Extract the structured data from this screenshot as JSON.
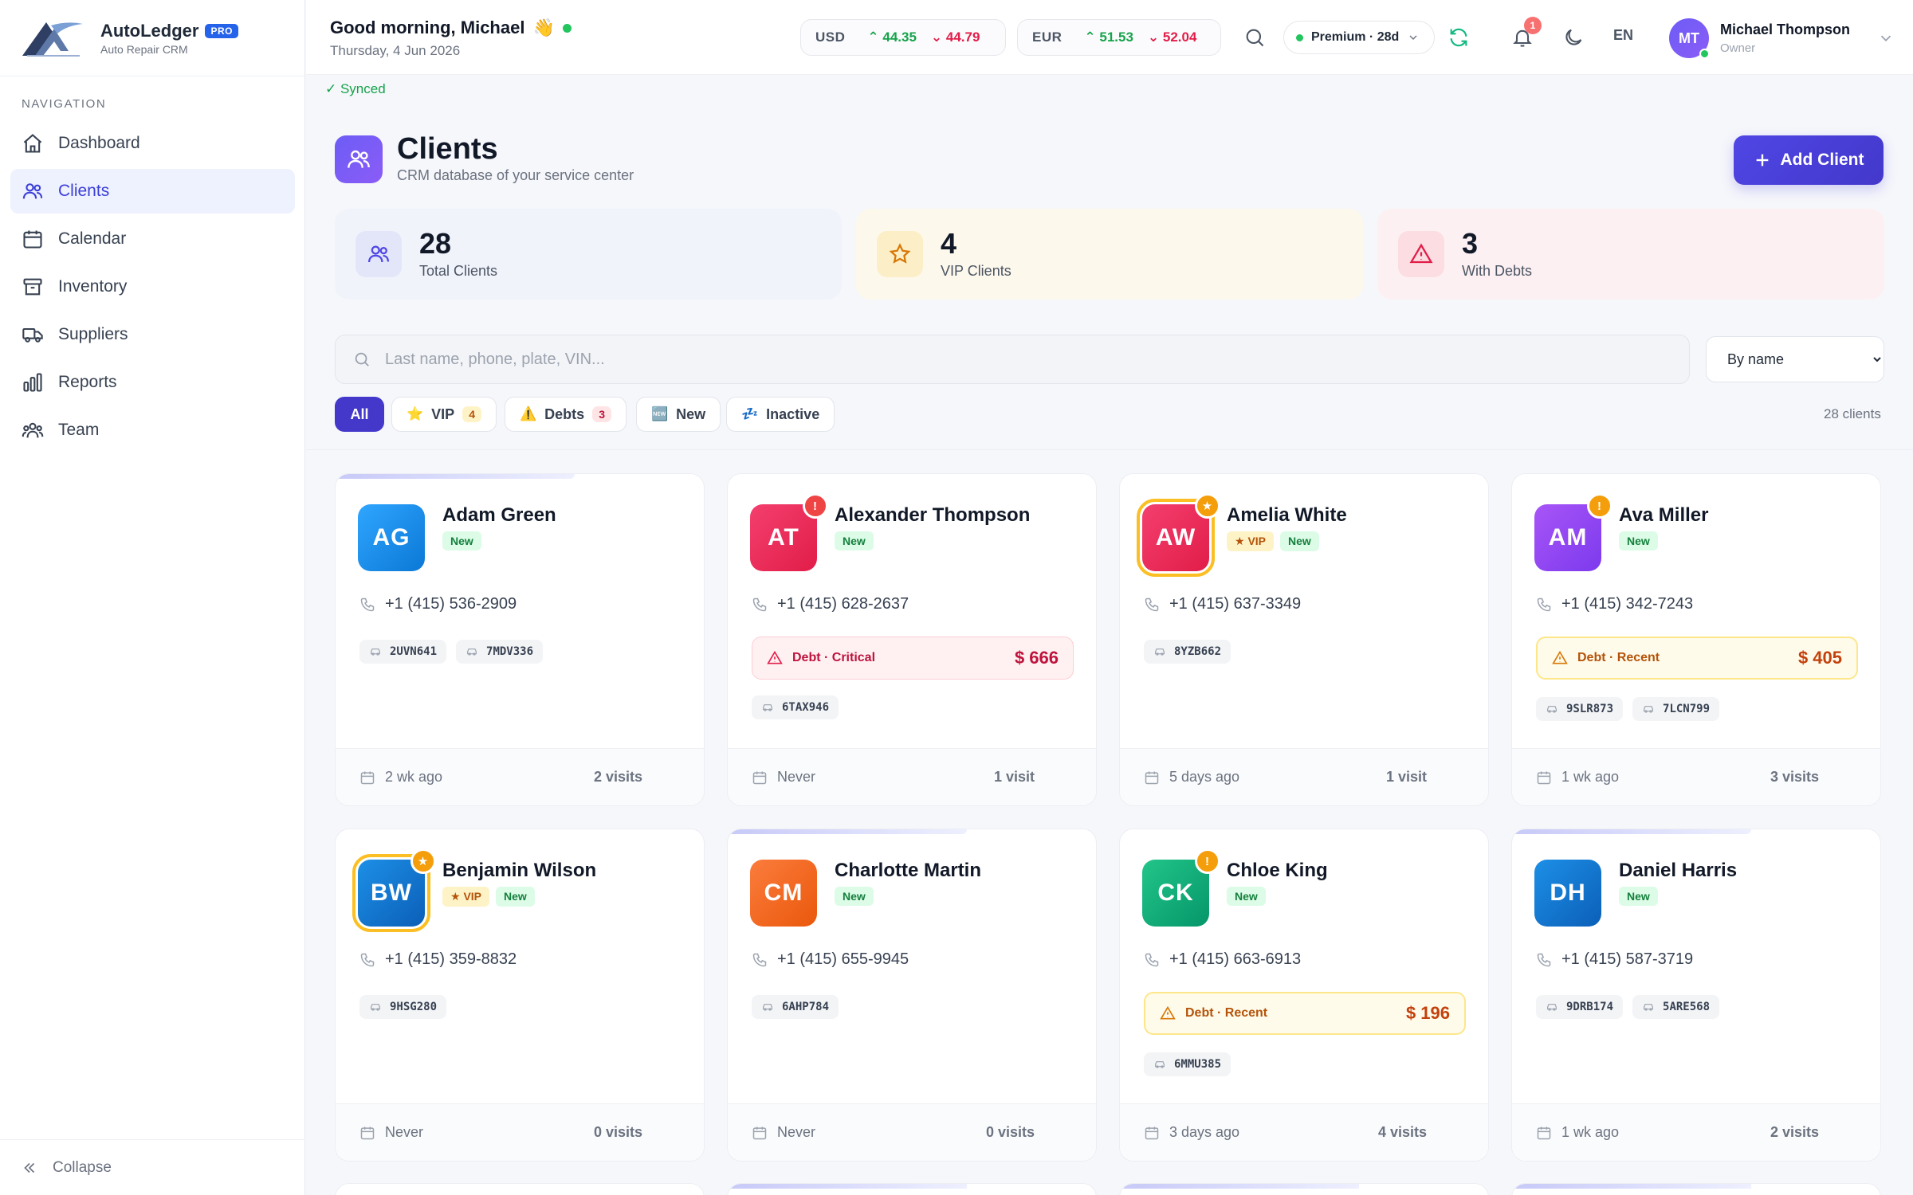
{
  "brand": {
    "name": "AutoLedger",
    "badge": "PRO",
    "subtitle": "Auto Repair CRM"
  },
  "sidebar": {
    "section_title": "NAVIGATION",
    "items": [
      {
        "label": "Dashboard",
        "icon": "home-icon"
      },
      {
        "label": "Clients",
        "icon": "users-icon",
        "active": true
      },
      {
        "label": "Calendar",
        "icon": "calendar-icon"
      },
      {
        "label": "Inventory",
        "icon": "archive-icon"
      },
      {
        "label": "Suppliers",
        "icon": "truck-icon"
      },
      {
        "label": "Reports",
        "icon": "bar-chart-icon"
      },
      {
        "label": "Team",
        "icon": "team-icon"
      }
    ],
    "collapse_label": "Collapse"
  },
  "header": {
    "greeting": "Good morning, Michael",
    "greeting_emoji": "👋",
    "date": "Thursday, 4 Jun 2026",
    "rates": [
      {
        "code": "USD",
        "buy": "44.35",
        "sell": "44.79"
      },
      {
        "code": "EUR",
        "buy": "51.53",
        "sell": "52.04"
      }
    ],
    "premium_label": "Premium · 28d",
    "notifications_count": "1",
    "language": "EN",
    "user": {
      "initials": "MT",
      "name": "Michael Thompson",
      "role": "Owner"
    }
  },
  "sync_status": "✓ Synced",
  "page": {
    "title": "Clients",
    "subtitle": "CRM database of your service center",
    "add_button_label": "Add Client"
  },
  "stats": [
    {
      "value": "28",
      "label": "Total Clients",
      "icon": "users-icon"
    },
    {
      "value": "4",
      "label": "VIP Clients",
      "icon": "star-icon"
    },
    {
      "value": "3",
      "label": "With Debts",
      "icon": "warning-icon"
    }
  ],
  "search": {
    "placeholder": "Last name, phone, plate, VIN...",
    "value": ""
  },
  "sort": {
    "selected": "By name",
    "options": [
      "By name"
    ]
  },
  "filters": [
    {
      "label": "All",
      "active": true
    },
    {
      "label": "VIP",
      "icon": "⭐",
      "count": "4"
    },
    {
      "label": "Debts",
      "icon": "⚠️",
      "count": "3"
    },
    {
      "label": "New",
      "icon": "🆕"
    },
    {
      "label": "Inactive",
      "icon": "💤"
    }
  ],
  "client_count_label": "28 clients",
  "colors": {
    "accent": "#4338ca",
    "vip": "#fbbf24",
    "debt_critical": "#e11d48",
    "debt_recent": "#d97706",
    "new": "#15803d"
  },
  "clients": [
    {
      "initials": "AG",
      "name": "Adam Green",
      "tags": [
        "New"
      ],
      "phone": "+1 (415) 536-2909",
      "plates": [
        "2UVN641",
        "7MDV336"
      ],
      "last_visit": "2 wk ago",
      "visits": "2 visits",
      "color": "#0ea5e9"
    },
    {
      "initials": "AT",
      "name": "Alexander Thompson",
      "tags": [
        "New"
      ],
      "phone": "+1 (415) 628-2637",
      "debt": {
        "label": "Debt · Critical",
        "amount": "$ 666",
        "level": "critical"
      },
      "plates": [
        "6TAX946"
      ],
      "last_visit": "Never",
      "visits": "1 visit",
      "color": "#e11d48",
      "badge": "debt-critical"
    },
    {
      "initials": "AW",
      "name": "Amelia White",
      "tags": [
        "VIP",
        "New"
      ],
      "phone": "+1 (415) 637-3349",
      "plates": [
        "8YZB662"
      ],
      "last_visit": "5 days ago",
      "visits": "1 visit",
      "color": "#e11d48",
      "badge": "vip"
    },
    {
      "initials": "AM",
      "name": "Ava Miller",
      "tags": [
        "New"
      ],
      "phone": "+1 (415) 342-7243",
      "debt": {
        "label": "Debt · Recent",
        "amount": "$ 405",
        "level": "recent"
      },
      "plates": [
        "9SLR873",
        "7LCN799"
      ],
      "last_visit": "1 wk ago",
      "visits": "3 visits",
      "color": "#8b5cf6",
      "badge": "debt-recent"
    },
    {
      "initials": "BW",
      "name": "Benjamin Wilson",
      "tags": [
        "VIP",
        "New"
      ],
      "phone": "+1 (415) 359-8832",
      "plates": [
        "9HSG280"
      ],
      "last_visit": "Never",
      "visits": "0 visits",
      "color": "#0284c7",
      "badge": "vip"
    },
    {
      "initials": "CM",
      "name": "Charlotte Martin",
      "tags": [
        "New"
      ],
      "phone": "+1 (415) 655-9945",
      "plates": [
        "6AHP784"
      ],
      "last_visit": "Never",
      "visits": "0 visits",
      "color": "#f97316"
    },
    {
      "initials": "CK",
      "name": "Chloe King",
      "tags": [
        "New"
      ],
      "phone": "+1 (415) 663-6913",
      "debt": {
        "label": "Debt · Recent",
        "amount": "$ 196",
        "level": "recent"
      },
      "plates": [
        "6MMU385"
      ],
      "last_visit": "3 days ago",
      "visits": "4 visits",
      "color": "#10b981",
      "badge": "debt-recent"
    },
    {
      "initials": "DH",
      "name": "Daniel Harris",
      "tags": [
        "New"
      ],
      "phone": "+1 (415) 587-3719",
      "plates": [
        "9DRB174",
        "5ARE568"
      ],
      "last_visit": "1 wk ago",
      "visits": "2 visits",
      "color": "#0284c7"
    }
  ]
}
